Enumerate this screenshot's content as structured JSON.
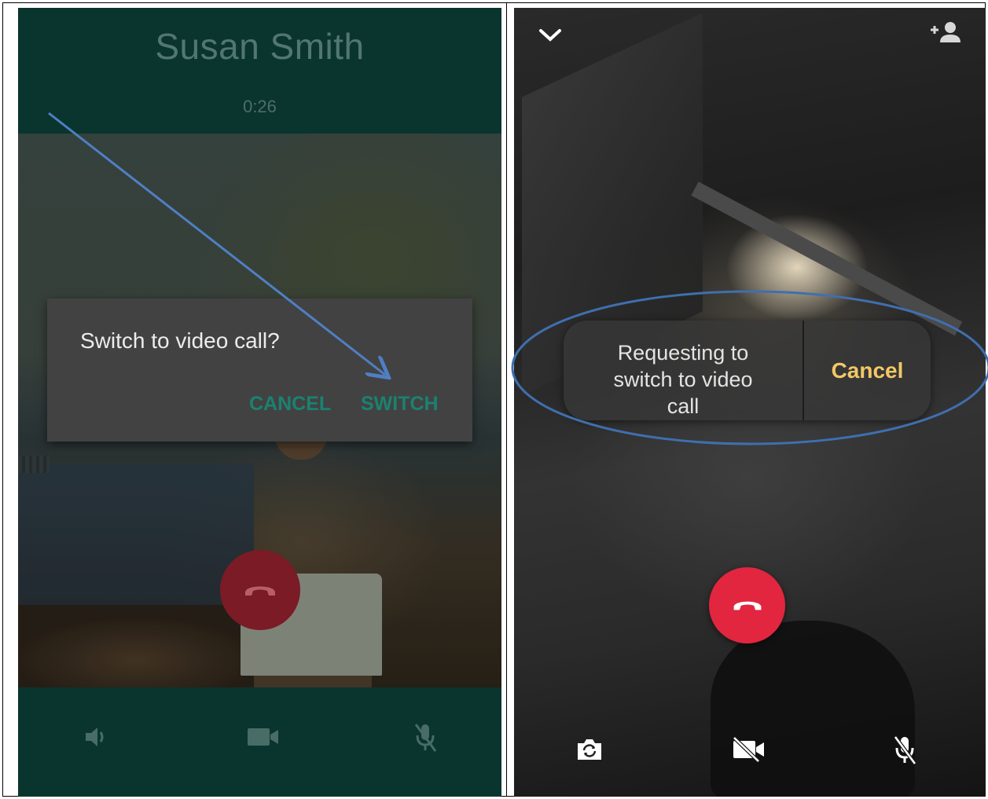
{
  "left_screen": {
    "caller_name": "Susan Smith",
    "call_timer": "0:26",
    "dialog": {
      "title": "Switch to video call?",
      "cancel_label": "CANCEL",
      "switch_label": "SWITCH"
    },
    "controls": {
      "speaker_icon": "speaker-icon",
      "video_icon": "video-camera-icon",
      "mic_icon": "mic-off-icon",
      "end_call_icon": "phone-hangup-icon"
    },
    "colors": {
      "background": "#0b3d35",
      "accent": "#1a8270",
      "end_call": "#7a1b25"
    }
  },
  "right_screen": {
    "request_text": "Requesting to switch to video call",
    "request_lines": [
      "Requesting to",
      "switch to video",
      "call"
    ],
    "cancel_label": "Cancel",
    "controls": {
      "collapse_icon": "chevron-down-icon",
      "add_person_icon": "add-person-icon",
      "flip_camera_icon": "flip-camera-icon",
      "video_off_icon": "video-off-icon",
      "mic_off_icon": "mic-off-icon",
      "end_call_icon": "phone-hangup-icon"
    },
    "colors": {
      "cancel": "#f2c866",
      "end_call": "#e2263f"
    }
  },
  "annotations": {
    "arrow_color": "#4f7fc4",
    "ellipse_color": "#3f6fae"
  }
}
